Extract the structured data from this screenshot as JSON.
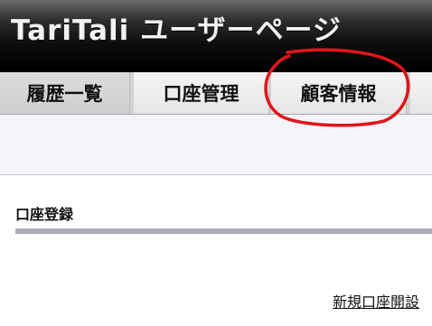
{
  "header": {
    "title": "TariTali ユーザーページ"
  },
  "tabs": [
    {
      "label": "履歴一覧"
    },
    {
      "label": "口座管理"
    },
    {
      "label": "顧客情報"
    }
  ],
  "annotation": {
    "color": "#e0141b"
  },
  "section": {
    "title": "口座登録"
  },
  "links": {
    "open_account": "新規口座開設"
  }
}
